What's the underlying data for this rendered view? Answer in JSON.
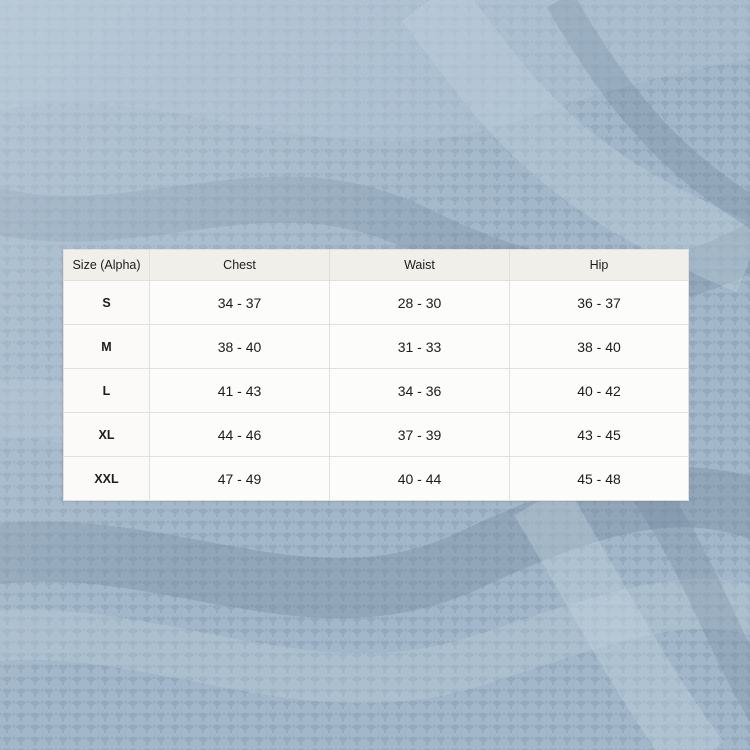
{
  "background": {
    "kind": "photo",
    "subject": "fabric-texture",
    "color": "#8fa6ba"
  },
  "size_table": {
    "headers": [
      "Size (Alpha)",
      "Chest",
      "Waist",
      "Hip"
    ],
    "rows": [
      {
        "size": "S",
        "chest": "34 - 37",
        "waist": "28 - 30",
        "hip": "36 - 37"
      },
      {
        "size": "M",
        "chest": "38 - 40",
        "waist": "31 - 33",
        "hip": "38 - 40"
      },
      {
        "size": "L",
        "chest": "41 - 43",
        "waist": "34 - 36",
        "hip": "40 - 42"
      },
      {
        "size": "XL",
        "chest": "44 - 46",
        "waist": "37 - 39",
        "hip": "43 - 45"
      },
      {
        "size": "XXL",
        "chest": "47 - 49",
        "waist": "40 - 44",
        "hip": "45 - 48"
      }
    ]
  }
}
